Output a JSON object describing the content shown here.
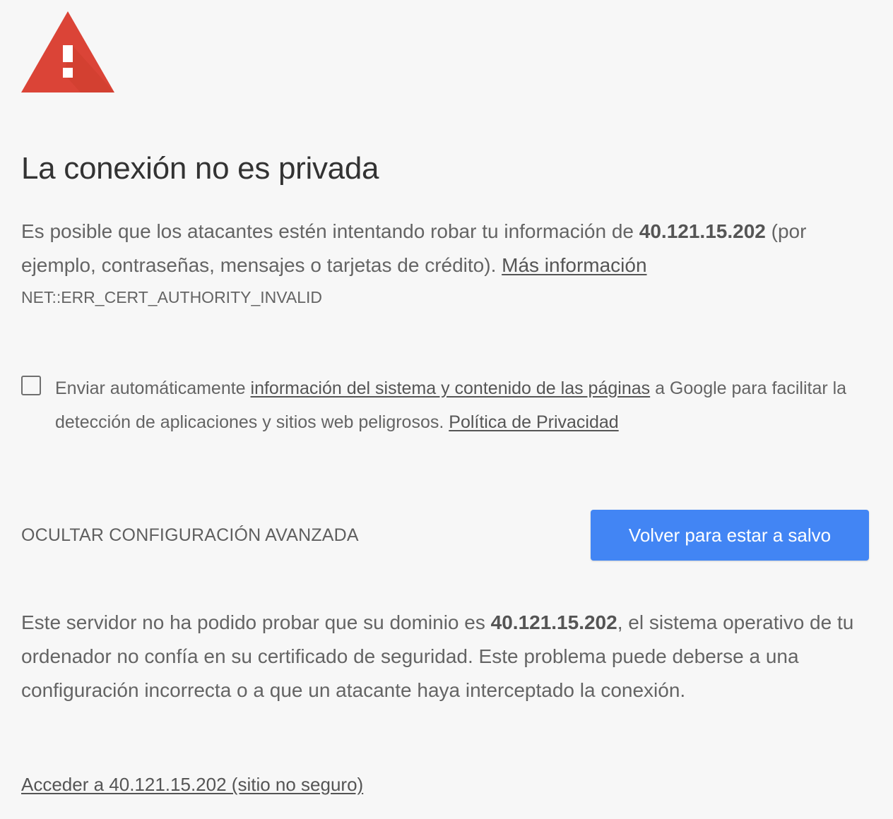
{
  "icon": {
    "name": "warning-triangle-icon",
    "color": "#db4437",
    "accent": "#ffffff"
  },
  "title": "La conexión no es privada",
  "intro": {
    "text_before": "Es posible que los atacantes estén intentando robar tu información de ",
    "host": "40.121.15.202",
    "text_after": " (por ejemplo, contraseñas, mensajes o tarjetas de crédito). ",
    "learn_more": "Más información"
  },
  "error_code": "NET::ERR_CERT_AUTHORITY_INVALID",
  "report": {
    "checked": false,
    "text_before": "Enviar automáticamente ",
    "link_system_info": "información del sistema y contenido de las páginas",
    "text_middle": " a Google para facilitar la detección de aplicaciones y sitios web peligrosos. ",
    "link_privacy": "Política de Privacidad"
  },
  "buttons": {
    "advanced": "OCULTAR CONFIGURACIÓN AVANZADA",
    "back_to_safety": "Volver para estar a salvo",
    "primary_color": "#4285f4"
  },
  "details": {
    "text_before": "Este servidor no ha podido probar que su dominio es ",
    "host": "40.121.15.202",
    "text_after": ", el sistema operativo de tu ordenador no confía en su certificado de seguridad. Este problema puede deberse a una configuración incorrecta o a que un atacante haya interceptado la conexión."
  },
  "proceed_link": "Acceder a 40.121.15.202 (sitio no seguro)"
}
